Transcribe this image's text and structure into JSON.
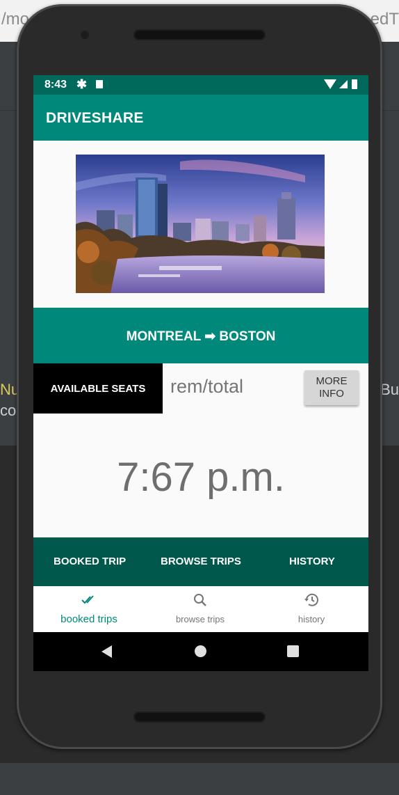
{
  "ide": {
    "url_left": "/mo",
    "url_right": "edT",
    "edge_left_1": "Nu",
    "edge_left_2": "cor",
    "edge_right": "Bu"
  },
  "status_bar": {
    "time": "8:43"
  },
  "app_bar": {
    "title": "DRIVESHARE"
  },
  "trip": {
    "route": "MONTREAL ➡ BOSTON",
    "seats_label": "AVAILABLE SEATS",
    "seats_value": "rem/total",
    "more_info_line1": "MORE",
    "more_info_line2": "INFO",
    "departure_time": "7:67 p.m."
  },
  "actions": {
    "booked_trip": "BOOKED TRIP",
    "browse_trips": "BROWSE TRIPS",
    "history": "HISTORY"
  },
  "bottom_nav": {
    "items": [
      {
        "label": "booked trips",
        "icon": "double-check-icon",
        "active": true
      },
      {
        "label": "browse trips",
        "icon": "search-icon",
        "active": false
      },
      {
        "label": "history",
        "icon": "history-icon",
        "active": false
      }
    ]
  },
  "colors": {
    "primary": "#00897b",
    "primary_dark": "#00695c",
    "button_bar": "#00574b"
  }
}
